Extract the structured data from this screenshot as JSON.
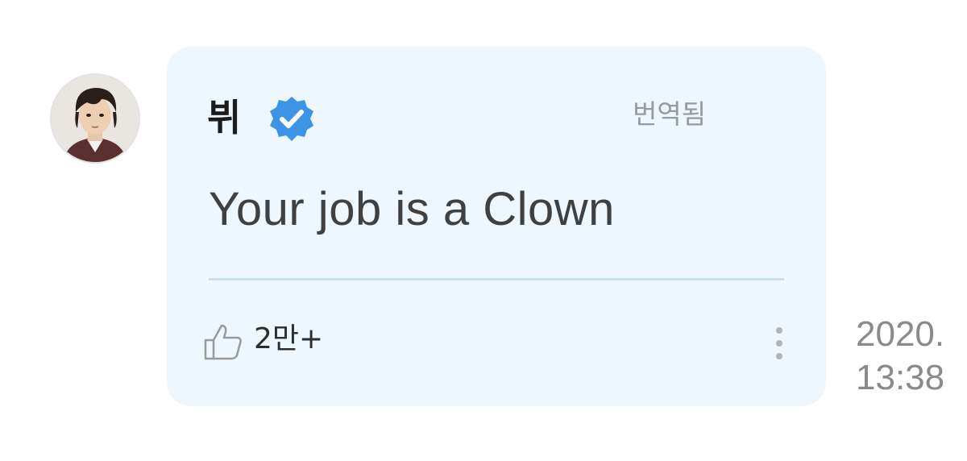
{
  "comment": {
    "author": "뷔",
    "verified_icon": "verified-badge-icon",
    "translated_label": "번역됨",
    "text": "Your job is a Clown",
    "like_icon": "thumbs-up-icon",
    "like_count": "2만+",
    "more_icon": "more-vertical-icon",
    "date": "2020.",
    "time": "13:38"
  },
  "colors": {
    "bubble_background": "#eef7fd",
    "verified_badge": "#3d93e6",
    "divider": "#c7e1ea",
    "muted_text": "#9a9a9a"
  }
}
